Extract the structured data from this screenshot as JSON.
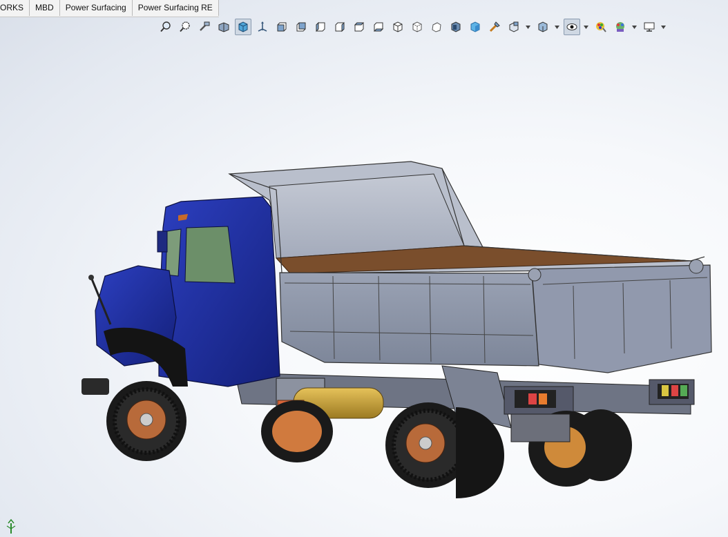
{
  "command_manager": {
    "tabs": [
      {
        "label": "ORKS"
      },
      {
        "label": "MBD"
      },
      {
        "label": "Power Surfacing"
      },
      {
        "label": "Power Surfacing RE"
      }
    ]
  },
  "heads_up_toolbar": {
    "buttons": [
      {
        "icon": "zoom-to-fit-icon"
      },
      {
        "icon": "zoom-to-area-icon"
      },
      {
        "icon": "previous-view-icon"
      },
      {
        "icon": "section-view-icon"
      },
      {
        "icon": "dynamic-annotation-view-icon",
        "active": true
      },
      {
        "icon": "view-orientation-icon"
      },
      {
        "icon": "front-view-icon"
      },
      {
        "icon": "back-view-icon"
      },
      {
        "icon": "left-view-icon"
      },
      {
        "icon": "right-view-icon"
      },
      {
        "icon": "top-view-icon"
      },
      {
        "icon": "bottom-view-icon"
      },
      {
        "icon": "isometric-view-icon"
      },
      {
        "icon": "trimetric-view-icon"
      },
      {
        "icon": "dimetric-view-icon"
      },
      {
        "icon": "normal-to-icon"
      },
      {
        "icon": "shaded-view-icon"
      },
      {
        "icon": "apply-scene-icon"
      },
      {
        "icon": "view-settings-icon"
      }
    ],
    "dropdown_buttons": [
      {
        "icon": "display-style-icon"
      },
      {
        "icon": "hide-show-items-icon",
        "active": true
      },
      {
        "icon": "edit-appearance-icon"
      },
      {
        "icon": "apply-scene-palette-icon"
      },
      {
        "icon": "view-display-monitor-icon"
      }
    ]
  },
  "colors": {
    "cab_blue": "#1f2e9c",
    "body_gray": "#8e97ab",
    "bed_wood": "#7a4e2c",
    "rim_copper": "#b86a3a",
    "tire_black": "#1a1a1a",
    "tank_gold": "#c9a23a",
    "accent": "#3d6ea8"
  }
}
